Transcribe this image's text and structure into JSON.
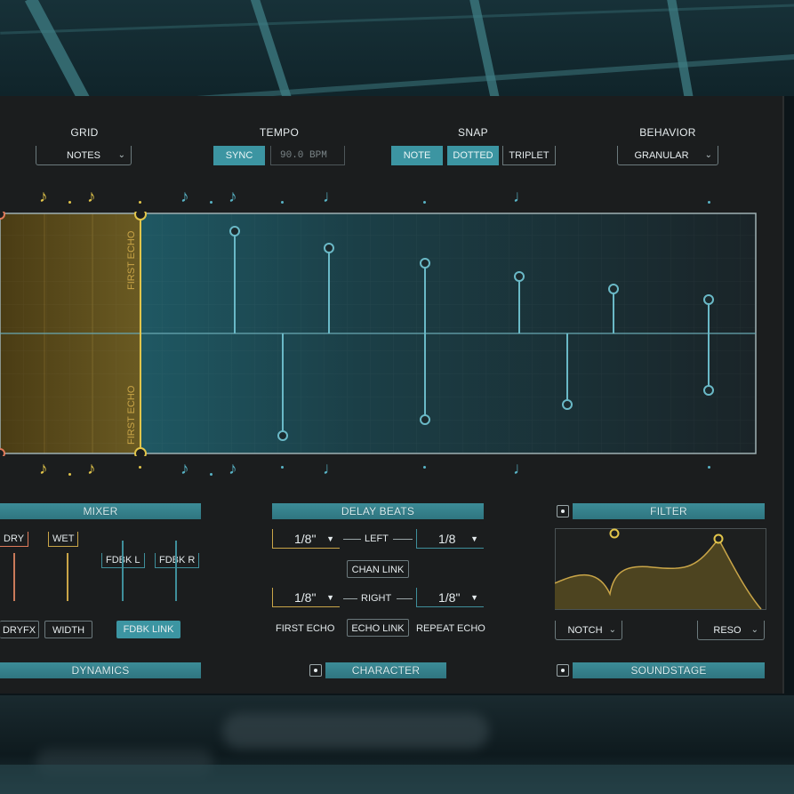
{
  "header": {
    "grid": {
      "label": "GRID",
      "value": "NOTES"
    },
    "tempo": {
      "label": "TEMPO",
      "sync_label": "SYNC",
      "bpm_value": "90.0 BPM"
    },
    "snap": {
      "label": "SNAP",
      "options": [
        "NOTE",
        "DOTTED",
        "TRIPLET"
      ],
      "active": [
        "NOTE",
        "DOTTED"
      ]
    },
    "behavior": {
      "label": "BEHAVIOR",
      "value": "GRANULAR"
    }
  },
  "echo_display": {
    "first_echo_label_top": "FIRST ECHO",
    "first_echo_label_bottom": "FIRST ECHO",
    "colors": {
      "first_echo": "#e2c54a",
      "echo": "#58b3c5",
      "display_border": "#9fb1b4"
    }
  },
  "mixer": {
    "title": "MIXER",
    "dry": "DRY",
    "wet": "WET",
    "fdbk_l": "FDBK L",
    "fdbk_r": "FDBK R",
    "dryfx": "DRYFX",
    "width": "WIDTH",
    "fdbk_link": "FDBK LINK"
  },
  "delay_beats": {
    "title": "DELAY BEATS",
    "left_label": "LEFT",
    "right_label": "RIGHT",
    "left_first": "1/8\"",
    "left_repeat": "1/8",
    "right_first": "1/8\"",
    "right_repeat": "1/8\"",
    "chan_link": "CHAN LINK",
    "first_echo": "FIRST ECHO",
    "echo_link": "ECHO LINK",
    "repeat_echo": "REPEAT ECHO"
  },
  "filter": {
    "title": "FILTER",
    "type_value": "NOTCH",
    "mode_value": "RESO"
  },
  "bottom_sections": {
    "dynamics": "DYNAMICS",
    "character": "CHARACTER",
    "soundstage": "SOUNDSTAGE"
  },
  "icons": [
    "eighth-note-icon",
    "quarter-note-icon",
    "chevron-down-icon",
    "power-icon",
    "filter-node-icon"
  ]
}
